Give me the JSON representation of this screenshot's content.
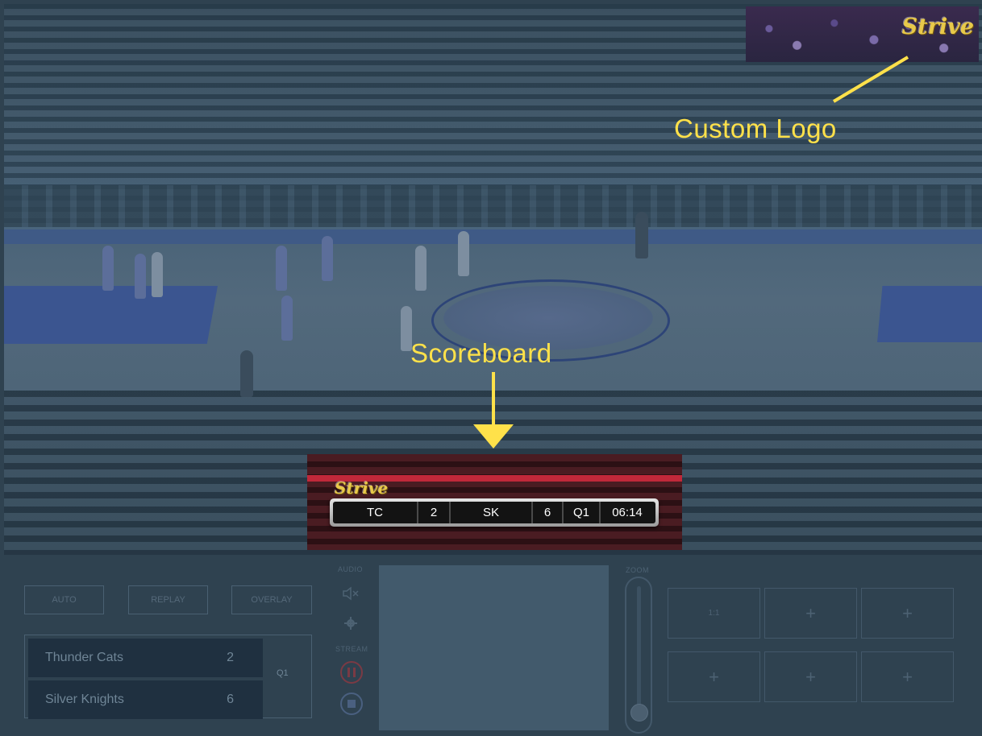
{
  "annotations": {
    "custom_logo": "Custom Logo",
    "scoreboard": "Scoreboard",
    "color": "#ffe14a"
  },
  "logo_preview": {
    "brand": "Strive"
  },
  "scoreboard_preview": {
    "brand": "Strive",
    "team1": "TC",
    "score1": "2",
    "team2": "SK",
    "score2": "6",
    "period": "Q1",
    "clock": "06:14"
  },
  "controls": {
    "mode_buttons": [
      {
        "label": "AUTO"
      },
      {
        "label": "REPLAY"
      },
      {
        "label": "OVERLAY"
      }
    ],
    "teams": [
      {
        "name": "Thunder Cats",
        "score": "2"
      },
      {
        "name": "Silver Knights",
        "score": "6"
      }
    ],
    "quarter": "Q1",
    "audio_label": "AUDIO",
    "stream_label": "STREAM",
    "zoom_label": "ZOOM",
    "presets": [
      "1:1",
      "+",
      "+",
      "+",
      "+",
      "+"
    ]
  },
  "icons": {
    "audio": "speaker-muted-icon",
    "settings": "gear-icon",
    "pause": "pause-icon",
    "stop": "stop-icon"
  },
  "colors": {
    "panel": "#2f4250",
    "annotation": "#ffe14a",
    "brand": "#e8c94a",
    "record": "#c0283a"
  }
}
